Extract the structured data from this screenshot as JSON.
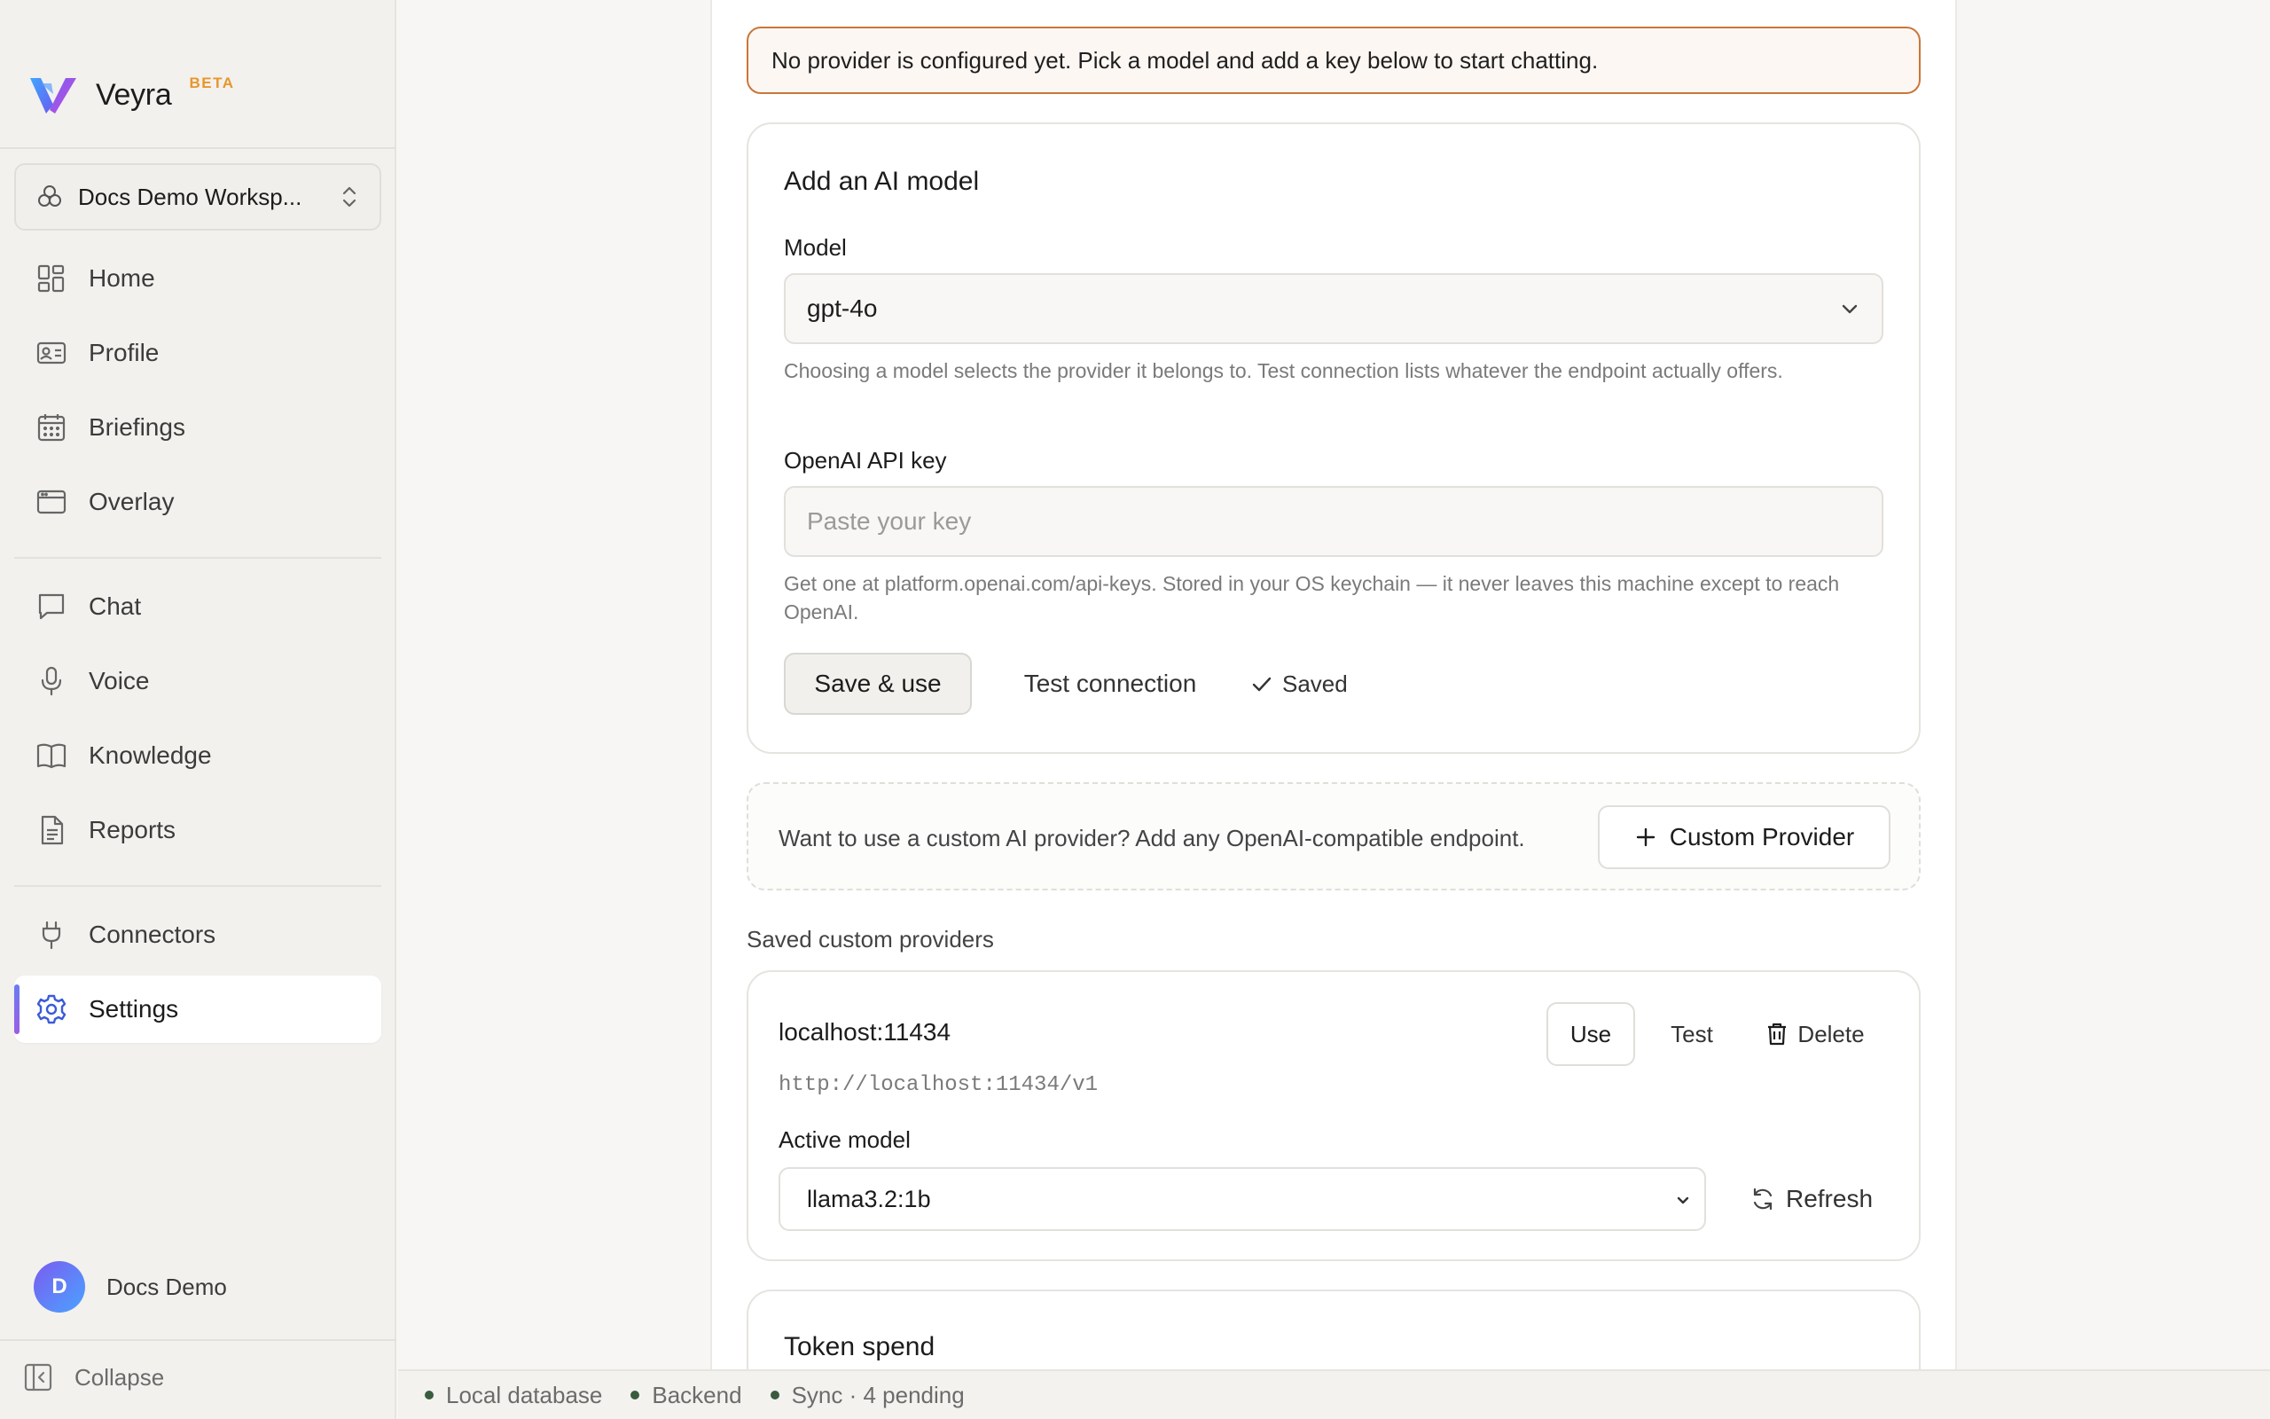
{
  "app": {
    "name": "Veyra",
    "badge": "BETA",
    "brand_colors": {
      "logo_primary": "#6a5cf0",
      "logo_secondary": "#3fa7ff",
      "badge": "#e8962b"
    }
  },
  "sidebar": {
    "workspace": {
      "name": "Docs Demo Worksp...",
      "icon": "workspace-icon"
    },
    "nav_groups": [
      [
        {
          "label": "Home",
          "icon": "dashboard-icon"
        },
        {
          "label": "Profile",
          "icon": "id-card-icon"
        },
        {
          "label": "Briefings",
          "icon": "calendar-icon"
        },
        {
          "label": "Overlay",
          "icon": "window-icon"
        }
      ],
      [
        {
          "label": "Chat",
          "icon": "chat-icon"
        },
        {
          "label": "Voice",
          "icon": "microphone-icon"
        },
        {
          "label": "Knowledge",
          "icon": "book-icon"
        },
        {
          "label": "Reports",
          "icon": "document-icon"
        }
      ],
      [
        {
          "label": "Connectors",
          "icon": "plug-icon"
        },
        {
          "label": "Settings",
          "icon": "gear-icon",
          "active": true
        }
      ]
    ],
    "user": {
      "initial": "D",
      "name": "Docs Demo"
    },
    "collapse_label": "Collapse"
  },
  "alert": {
    "text": "No provider is configured yet. Pick a model and add a key below to start chatting.",
    "border_color": "#c8773a"
  },
  "add_model": {
    "title": "Add an AI model",
    "model_label": "Model",
    "model_value": "gpt-4o",
    "model_help": "Choosing a model selects the provider it belongs to. Test connection lists whatever the endpoint actually offers.",
    "key_label": "OpenAI API key",
    "key_placeholder": "Paste your key",
    "key_help": "Get one at platform.openai.com/api-keys. Stored in your OS keychain — it never leaves this machine except to reach OpenAI.",
    "save_label": "Save & use",
    "test_label": "Test connection",
    "saved_label": "Saved"
  },
  "custom_provider": {
    "text": "Want to use a custom AI provider? Add any OpenAI-compatible endpoint.",
    "button_label": "Custom Provider"
  },
  "saved_providers": {
    "section_label": "Saved custom providers",
    "items": [
      {
        "name": "localhost:11434",
        "url": "http://localhost:11434/v1",
        "use_label": "Use",
        "test_label": "Test",
        "delete_label": "Delete",
        "active_model_label": "Active model",
        "active_model_value": "llama3.2:1b",
        "refresh_label": "Refresh"
      }
    ]
  },
  "token_spend": {
    "title": "Token spend"
  },
  "status_bar": [
    {
      "label": "Local database",
      "color": "#3b5b3f"
    },
    {
      "label": "Backend",
      "color": "#3b5b3f"
    },
    {
      "label": "Sync · 4 pending",
      "color": "#3b5b3f"
    }
  ]
}
